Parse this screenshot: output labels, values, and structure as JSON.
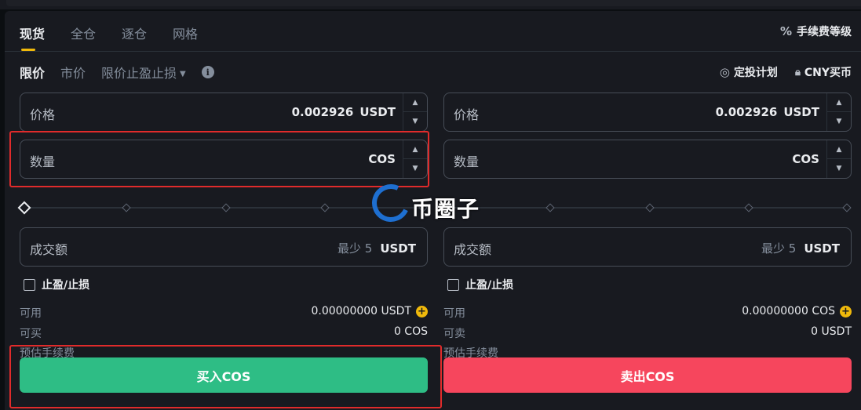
{
  "tabs": [
    {
      "label": "现货"
    },
    {
      "label": "全仓"
    },
    {
      "label": "逐仓"
    },
    {
      "label": "网格"
    }
  ],
  "fee_level": "手续费等级",
  "order_types": [
    {
      "label": "限价"
    },
    {
      "label": "市价"
    },
    {
      "label": "限价止盈止损"
    }
  ],
  "top_links": {
    "dca": "定投计划",
    "cny_buy": "CNY买币"
  },
  "buy": {
    "price_label": "价格",
    "price_value": "0.002926",
    "price_unit": "USDT",
    "qty_label": "数量",
    "qty_unit": "COS",
    "total_label": "成交额",
    "total_min": "最少 5",
    "total_unit": "USDT",
    "tpsl_label": "止盈/止损",
    "avail_label": "可用",
    "avail_value": "0.00000000 USDT",
    "max_label": "可买",
    "max_value": "0 COS",
    "fee_label": "预估手续费",
    "button_label": "买入COS"
  },
  "sell": {
    "price_label": "价格",
    "price_value": "0.002926",
    "price_unit": "USDT",
    "qty_label": "数量",
    "qty_unit": "COS",
    "total_label": "成交额",
    "total_min": "最少 5",
    "total_unit": "USDT",
    "tpsl_label": "止盈/止损",
    "avail_label": "可用",
    "avail_value": "0.00000000 COS",
    "max_label": "可卖",
    "max_value": "0 USDT",
    "fee_label": "预估手续费",
    "button_label": "卖出COS"
  },
  "watermark": "币圈子",
  "colors": {
    "buy": "#2ebd85",
    "sell": "#f6465d",
    "accent": "#f0b90b",
    "highlight": "#e02b2b"
  }
}
